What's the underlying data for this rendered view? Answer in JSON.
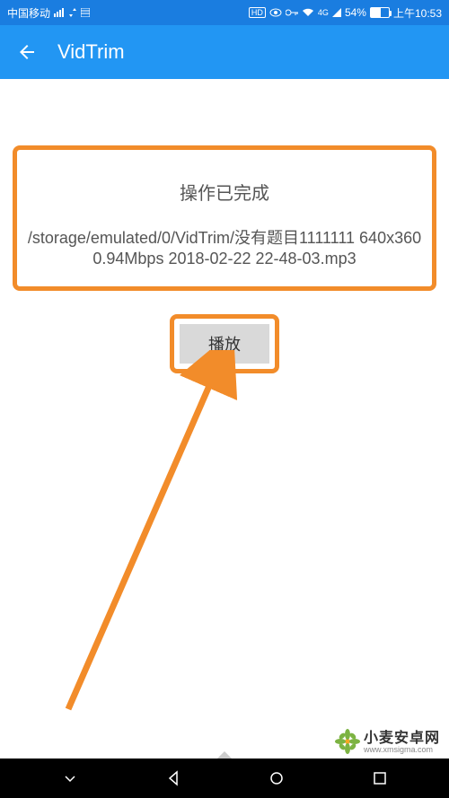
{
  "statusBar": {
    "carrier": "中国移动",
    "batteryPercent": "54%",
    "time": "上午10:53",
    "hdLabel": "HD",
    "networkLabel": "4G"
  },
  "appBar": {
    "title": "VidTrim"
  },
  "info": {
    "title": "操作已完成",
    "path": "/storage/emulated/0/VidTrim/没有题目1111111 640x360 0.94Mbps 2018-02-22 22-48-03.mp3"
  },
  "playButton": {
    "label": "播放"
  },
  "watermark": {
    "main": "小麦安卓网",
    "sub": "www.xmsigma.com"
  },
  "colors": {
    "primary": "#2296f3",
    "highlight": "#f28c2a"
  }
}
